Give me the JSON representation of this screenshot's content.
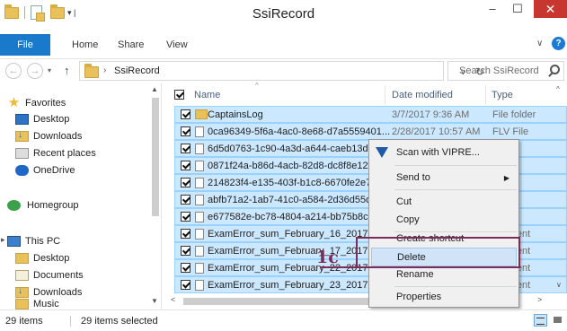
{
  "window": {
    "title": "SsiRecord",
    "minimize_glyph": "–",
    "maximize_glyph": "☐",
    "close_glyph": "✕"
  },
  "ribbon": {
    "tabs": [
      "File",
      "Home",
      "Share",
      "View"
    ],
    "file_tab_color": "#1979ca"
  },
  "address": {
    "path": "SsiRecord",
    "back_glyph": "←",
    "forward_glyph": "→",
    "up_glyph": "↑",
    "search_placeholder": "Search SsiRecord"
  },
  "navigation": {
    "favorites_label": "Favorites",
    "favorites": [
      "Desktop",
      "Downloads",
      "Recent places",
      "OneDrive"
    ],
    "homegroup_label": "Homegroup",
    "thispc_label": "This PC",
    "thispc_items": [
      "Desktop",
      "Documents",
      "Downloads",
      "Music"
    ]
  },
  "columns": {
    "name": "Name",
    "date": "Date modified",
    "type": "Type"
  },
  "files": [
    {
      "name": "CaptainsLog",
      "date": "3/7/2017 9:36 AM",
      "type": "File folder",
      "icon": "folder-icon"
    },
    {
      "name": "0ca96349-5f6a-4ac0-8e68-d7a5559401...",
      "date": "2/28/2017 10:57 AM",
      "type": "FLV File",
      "icon": "file-icon"
    },
    {
      "name": "6d5d0763-1c90-4a3d-a644-caeb13d8",
      "date": "",
      "type": "e",
      "icon": "file-icon"
    },
    {
      "name": "0871f24a-b86d-4acb-82d8-dc8f8e12f",
      "date": "",
      "type": "",
      "icon": "file-icon"
    },
    {
      "name": "214823f4-e135-403f-b1c8-6670fe2e76",
      "date": "",
      "type": "e",
      "icon": "file-icon"
    },
    {
      "name": "abfb71a2-1ab7-41c0-a584-2d36d55d",
      "date": "",
      "type": "e",
      "icon": "file-icon"
    },
    {
      "name": "e677582e-bc78-4804-a214-bb75b8c5",
      "date": "",
      "type": "e",
      "icon": "file-icon"
    },
    {
      "name": "ExamError_sum_February_16_2017",
      "date": "",
      "type": "ocument",
      "icon": "file-icon"
    },
    {
      "name": "ExamError_sum_February_17_2017",
      "date": "",
      "type": "ocument",
      "icon": "file-icon"
    },
    {
      "name": "ExamError_sum_February_22_2017",
      "date": "",
      "type": "ocument",
      "icon": "file-icon"
    },
    {
      "name": "ExamError_sum_February_23_2017",
      "date": "",
      "type": "ocument",
      "icon": "file-icon"
    }
  ],
  "context_menu": {
    "scan": "Scan with VIPRE...",
    "send_to": "Send to",
    "cut": "Cut",
    "copy": "Copy",
    "create_shortcut": "Create shortcut",
    "delete": "Delete",
    "rename": "Rename",
    "properties": "Properties"
  },
  "annotation": {
    "label": "1c",
    "color": "#7b2d58"
  },
  "status": {
    "count": "29 items",
    "selected": "29 items selected"
  },
  "selection_color": "#cce8ff"
}
